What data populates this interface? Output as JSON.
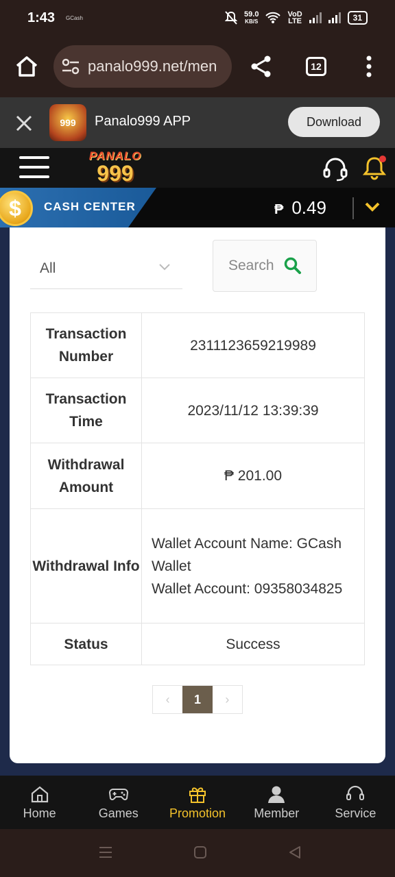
{
  "status_bar": {
    "time": "1:43",
    "app_note": "GCash",
    "net_speed": "59.0",
    "net_unit": "KB/S",
    "net_type_top": "VoD",
    "net_type_bottom": "LTE",
    "battery": "31"
  },
  "browser": {
    "url": "panalo999.net/men",
    "tab_count": "12"
  },
  "app_banner": {
    "title": "Panalo999 APP",
    "download_label": "Download",
    "logo_text": "999"
  },
  "site_header": {
    "logo_top": "PANALO",
    "logo_num": "999"
  },
  "cash_center": {
    "label": "CASH CENTER",
    "currency": "₱",
    "balance": "0.49",
    "coin_symbol": "$"
  },
  "filter": {
    "selected": "All",
    "search_label": "Search"
  },
  "transaction": {
    "rows": [
      {
        "key": "Transaction Number",
        "value": "2311123659219989"
      },
      {
        "key": "Transaction Time",
        "value": "2023/11/12 13:39:39"
      },
      {
        "key": "Withdrawal Amount",
        "value": "₱ 201.00"
      },
      {
        "key": "Withdrawal Info",
        "value": "Wallet Account Name: GCash Wallet\nWallet Account: 09358034825"
      },
      {
        "key": "Status",
        "value": "Success"
      }
    ]
  },
  "pagination": {
    "prev": "‹",
    "current": "1",
    "next": "›"
  },
  "bottom_nav": [
    {
      "label": "Home",
      "icon": "home-icon"
    },
    {
      "label": "Games",
      "icon": "gamepad-icon"
    },
    {
      "label": "Promotion",
      "icon": "gift-icon"
    },
    {
      "label": "Member",
      "icon": "member-icon"
    },
    {
      "label": "Service",
      "icon": "headset-icon"
    }
  ],
  "colors": {
    "accent": "#f4c22b",
    "cash_tag": "#2c6fb0",
    "pager_active": "#6b5e4c",
    "search_icon": "#1aa14a"
  }
}
